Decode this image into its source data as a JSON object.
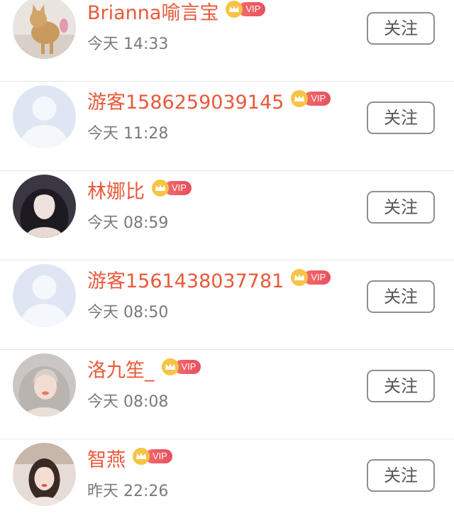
{
  "follow_label": "关注",
  "vip_label": "VIP",
  "colors": {
    "name": "#e8593a",
    "vip_crown": "#f6c445",
    "vip_tag": "#e84f5f",
    "time": "#7a7a7a",
    "button_border": "#8f8f8f"
  },
  "visitors": [
    {
      "name": "Brianna喻言宝",
      "time": "今天 14:33",
      "avatar": "cat-photo"
    },
    {
      "name": "游客1586259039145",
      "time": "今天 11:28",
      "avatar": "default-person"
    },
    {
      "name": "林娜比",
      "time": "今天 08:59",
      "avatar": "girl-photo"
    },
    {
      "name": "游客1561438037781",
      "time": "今天 08:50",
      "avatar": "default-person"
    },
    {
      "name": "洛九笙_",
      "time": "今天 08:08",
      "avatar": "girl-photo"
    },
    {
      "name": "智燕",
      "time": "昨天 22:26",
      "avatar": "girl-photo"
    }
  ]
}
